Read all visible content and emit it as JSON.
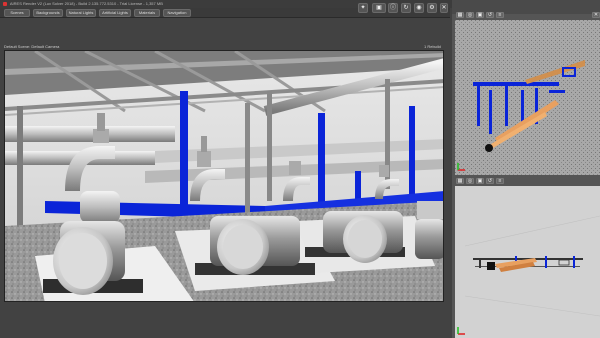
{
  "window": {
    "title": "AIRES Render V2 (Lux Solver 2018) - Build 2.135.772.5310 - Trial License - 1,357 MB"
  },
  "menu": {
    "tabs": [
      "Scenes",
      "Backgrounds",
      "Natural Lights",
      "Artificial Lights",
      "Materials",
      "Navigation"
    ]
  },
  "toolbar": {
    "icons": [
      "pin-icon",
      "camera-icon",
      "info-icon",
      "refresh-icon",
      "preview-icon",
      "settings-icon"
    ]
  },
  "viewport": {
    "label": "Default Scene: Default Camera",
    "side_label": "1 Rebuild"
  },
  "colors": {
    "pipe_blue": "#0a24d8",
    "motor_silver": "#b8b8b8",
    "frame_gray": "#8a8a8a",
    "accent_orange": "#e08a3a",
    "axis_red": "#e02020",
    "axis_green": "#20c020"
  }
}
